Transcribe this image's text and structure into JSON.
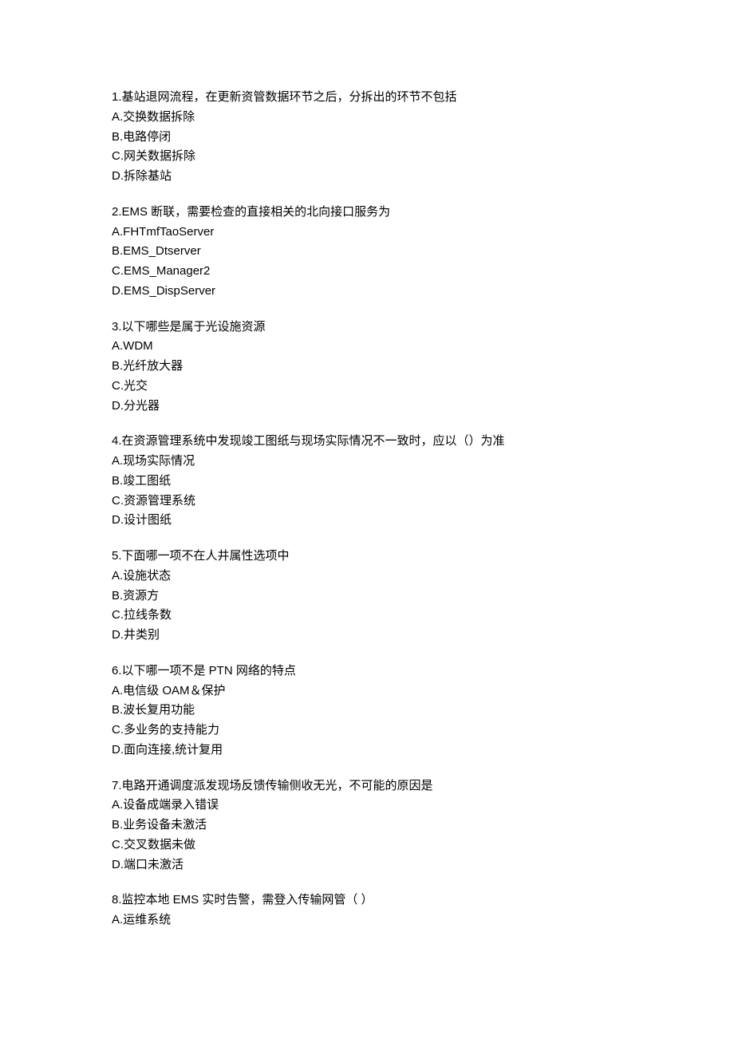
{
  "questions": [
    {
      "text": "1.基站退网流程，在更新资管数据环节之后，分拆出的环节不包括",
      "options": [
        "A.交换数据拆除",
        "B.电路停闭",
        "C.网关数据拆除",
        "D.拆除基站"
      ]
    },
    {
      "text": "2.EMS 断联，需要检查的直接相关的北向接口服务为",
      "options": [
        "A.FHTmfTaoServer",
        "B.EMS_Dtserver",
        "C.EMS_Manager2",
        "D.EMS_DispServer"
      ]
    },
    {
      "text": "3.以下哪些是属于光设施资源",
      "options": [
        "A.WDM",
        "B.光纤放大器",
        "C.光交",
        "D.分光器"
      ]
    },
    {
      "text": "4.在资源管理系统中发现竣工图纸与现场实际情况不一致时，应以（）为准",
      "options": [
        "A.现场实际情况",
        "B.竣工图纸",
        "C.资源管理系统",
        "D.设计图纸"
      ]
    },
    {
      "text": "5.下面哪一项不在人井属性选项中",
      "options": [
        "A.设施状态",
        "B.资源方",
        "C.拉线条数",
        "D.井类别"
      ]
    },
    {
      "text": "6.以下哪一项不是 PTN 网络的特点",
      "options": [
        "A.电信级 OAM＆保护",
        "B.波长复用功能",
        "C.多业务的支持能力",
        "D.面向连接,统计复用"
      ]
    },
    {
      "text": "7.电路开通调度派发现场反馈传输侧收无光，不可能的原因是",
      "options": [
        "A.设备成端录入错误",
        "B.业务设备未激活",
        "C.交叉数据未做",
        "D.端口未激活"
      ]
    },
    {
      "text": "8.监控本地 EMS 实时告警，需登入传输网管（ ）",
      "options": [
        "A.运维系统"
      ]
    }
  ]
}
